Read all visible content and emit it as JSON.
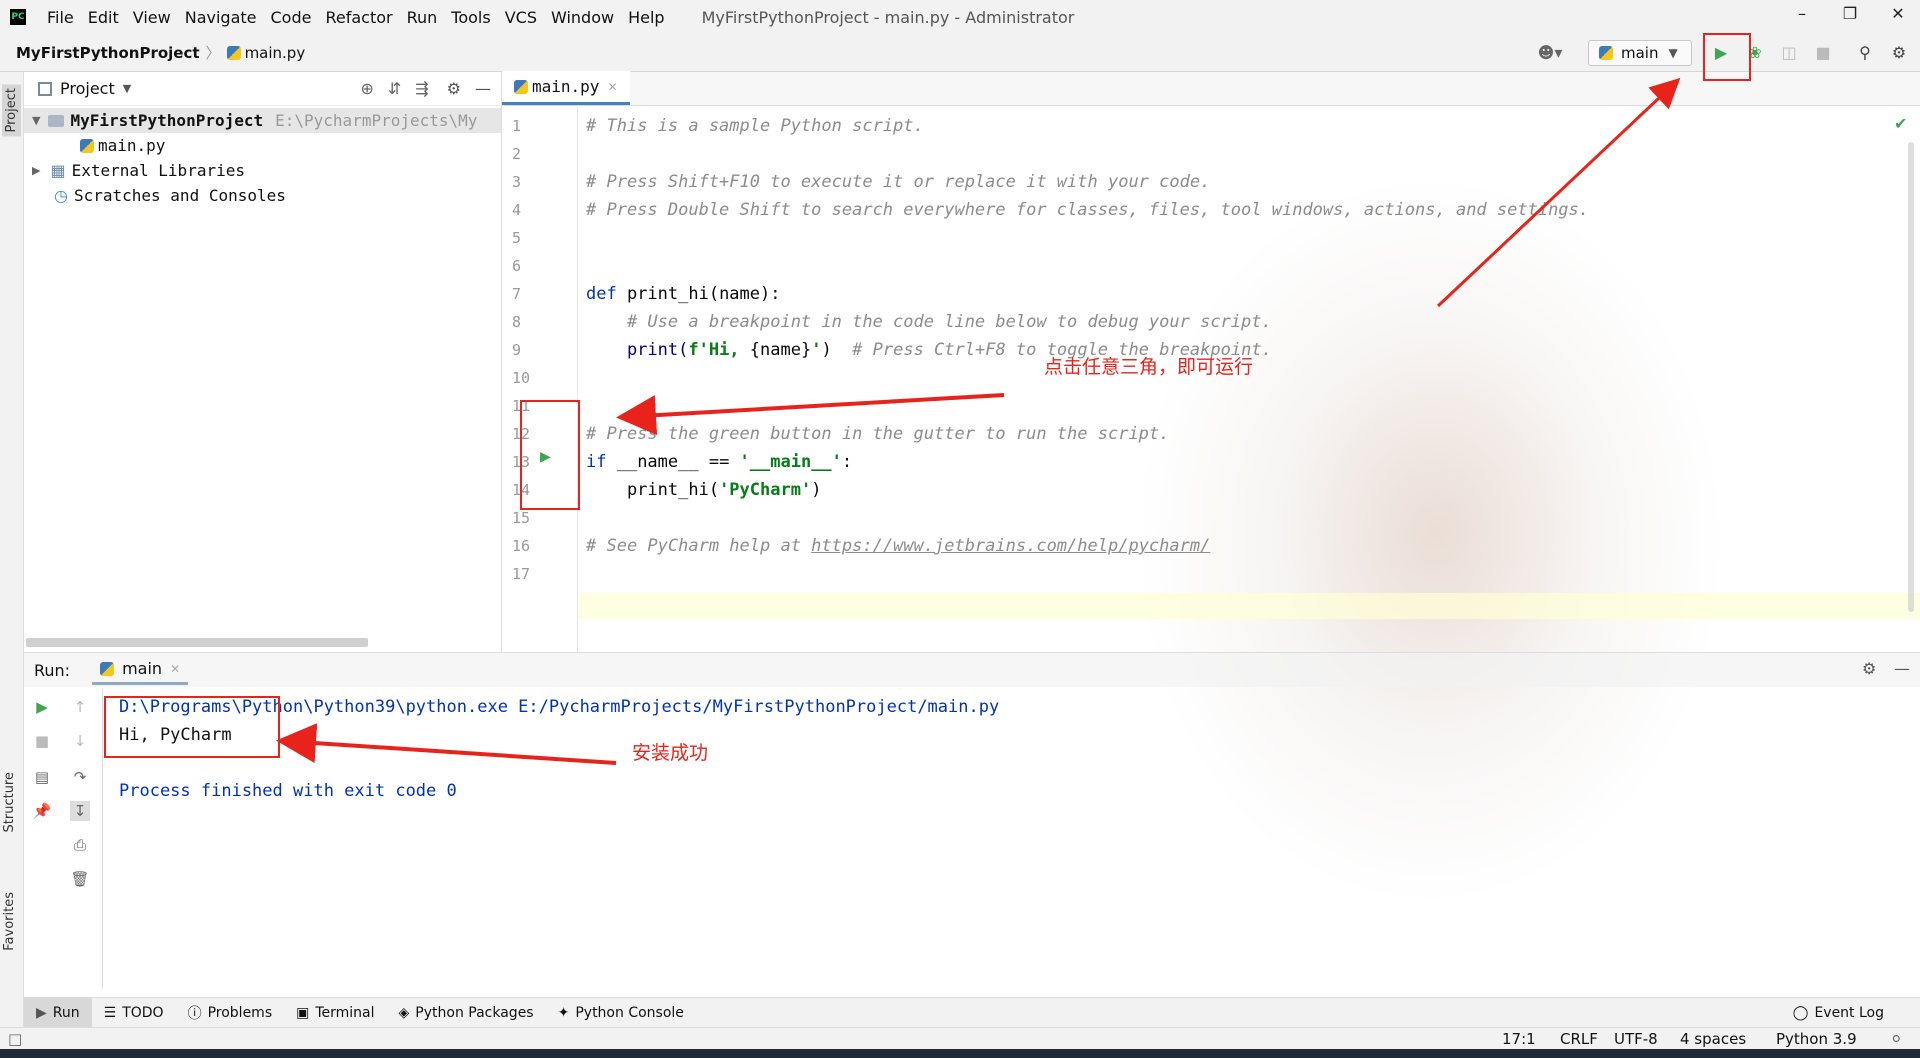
{
  "menubar": {
    "items": [
      "File",
      "Edit",
      "View",
      "Navigate",
      "Code",
      "Refactor",
      "Run",
      "Tools",
      "VCS",
      "Window",
      "Help"
    ],
    "window_title": "MyFirstPythonProject - main.py - Administrator"
  },
  "navbar": {
    "project": "MyFirstPythonProject",
    "file": "main.py",
    "run_config": "main"
  },
  "left_stripe": {
    "project": "Project",
    "structure": "Structure",
    "favorites": "Favorites"
  },
  "project_panel": {
    "title": "Project",
    "tree": {
      "root_name": "MyFirstPythonProject",
      "root_path": "E:\\PycharmProjects\\My",
      "main_file": "main.py",
      "external_libraries": "External Libraries",
      "scratches": "Scratches and Consoles"
    }
  },
  "editor": {
    "tab": "main.py",
    "line_numbers": [
      "1",
      "2",
      "3",
      "4",
      "5",
      "6",
      "7",
      "8",
      "9",
      "10",
      "11",
      "12",
      "13",
      "14",
      "15",
      "16",
      "17"
    ],
    "code": {
      "l1": "# This is a sample Python script.",
      "l3": "# Press Shift+F10 to execute it or replace it with your code.",
      "l4": "# Press Double Shift to search everywhere for classes, files, tool windows, actions, and settings.",
      "l7_kw": "def",
      "l7_rest": " print_hi(name):",
      "l8": "    # Use a breakpoint in the code line below to debug your script.",
      "l9_a": "    print(",
      "l9_str": "f'Hi, ",
      "l9_b": "{name}",
      "l9_str2": "'",
      "l9_c": ")  ",
      "l9_cmt": "# Press Ctrl+F8 to toggle the breakpoint.",
      "l12": "# Press the green button in the gutter to run the script.",
      "l13_kw": "if",
      "l13_a": " __name__ == ",
      "l13_str": "'__main__'",
      "l13_b": ":",
      "l14_a": "    print_hi(",
      "l14_str": "'PyCharm'",
      "l14_b": ")",
      "l16_cmt": "# See PyCharm help at ",
      "l16_link": "https://www.jetbrains.com/help/pycharm/"
    }
  },
  "run_panel": {
    "label": "Run:",
    "tab": "main",
    "console": {
      "command": "D:\\Programs\\Python\\Python39\\python.exe E:/PycharmProjects/MyFirstPythonProject/main.py",
      "output": "Hi, PyCharm",
      "exit": "Process finished with exit code 0"
    }
  },
  "bottom_tools": [
    "Run",
    "TODO",
    "Problems",
    "Terminal",
    "Python Packages",
    "Python Console"
  ],
  "event_log": "Event Log",
  "statusbar": {
    "position": "17:1",
    "line_sep": "CRLF",
    "encoding": "UTF-8",
    "indent": "4 spaces",
    "interpreter": "Python 3.9"
  },
  "annotations": {
    "gutter_note": "点击任意三角，即可运行",
    "success_note": "安装成功"
  },
  "colors": {
    "annotation": "#e8231b",
    "run_green": "#3fa64f",
    "accent": "#4083c9"
  }
}
